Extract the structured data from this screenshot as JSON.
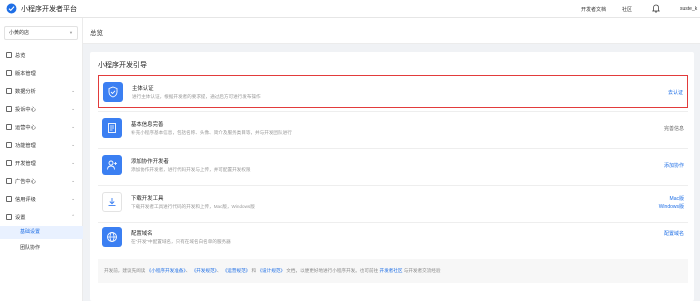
{
  "app": {
    "title": "小程序开发者平台"
  },
  "topbar": {
    "links": [
      "开发者文档",
      "社区"
    ],
    "user": "suste_k"
  },
  "sidebar": {
    "account": "小黄的店",
    "items": [
      {
        "label": "总览",
        "icon": "home-icon",
        "expand": false
      },
      {
        "label": "版本管理",
        "icon": "version-icon",
        "expand": false
      },
      {
        "label": "数据分析",
        "icon": "chart-icon",
        "expand": true
      },
      {
        "label": "投诉中心",
        "icon": "complaint-icon",
        "expand": true
      },
      {
        "label": "运营中心",
        "icon": "operation-icon",
        "expand": true
      },
      {
        "label": "功能管理",
        "icon": "function-icon",
        "expand": true
      },
      {
        "label": "开发管理",
        "icon": "dev-icon",
        "expand": true
      },
      {
        "label": "广告中心",
        "icon": "ad-icon",
        "expand": true
      },
      {
        "label": "信用评级",
        "icon": "credit-icon",
        "expand": true
      },
      {
        "label": "设置",
        "icon": "settings-icon",
        "expand": true
      }
    ],
    "subitems": [
      {
        "label": "基础设置",
        "active": true
      },
      {
        "label": "团队协作",
        "active": false
      }
    ]
  },
  "breadcrumb": "总览",
  "guide": {
    "title": "小程序开发引导",
    "tasks": [
      {
        "title": "主体认证",
        "desc": "进行主体认证，根据开发者的要求提，通过后方可进行发布操作",
        "action": "去认证",
        "icon": "shield-check-icon",
        "highlight": true,
        "action_gray": false
      },
      {
        "title": "基本信息完善",
        "desc": "补充小程序基本信息，包括名称、头像、简介及服务类目等，并与开发团队进行",
        "action": "完善信息",
        "icon": "document-icon",
        "highlight": false,
        "action_gray": true
      },
      {
        "title": "添加协作开发者",
        "desc": "添加协作开发者，进行代码开发与上传，并可配置开发权限",
        "action": "添加协作",
        "icon": "user-add-icon",
        "highlight": false,
        "action_gray": false
      },
      {
        "title": "下载开发工具",
        "desc": "下载开发者工具进行代码的开发和上传，Mac版，Windows版",
        "action": "Mac版",
        "action2": "Windows版",
        "icon": "download-icon",
        "highlight": false,
        "action_gray": false
      },
      {
        "title": "配置域名",
        "desc": "在\"开发\"中配置域名，只有在域名白名单的服务器",
        "action": "配置域名",
        "icon": "globe-icon",
        "highlight": false,
        "action_gray": false
      }
    ]
  },
  "footer": {
    "prefix": "开发前，建议先阅读",
    "links": [
      "《小程序开发准备》",
      "《开发规范》",
      "《运营规范》",
      "《设计规范》"
    ],
    "mid": "文档，以便更好地进行小程序开发。也可前往",
    "community": "开发者社区",
    "suffix": "与开发者交流经验"
  },
  "colors": {
    "accent": "#1f6fe6",
    "highlight": "#e23b3b",
    "icon_bg": "#3b7ff2"
  }
}
